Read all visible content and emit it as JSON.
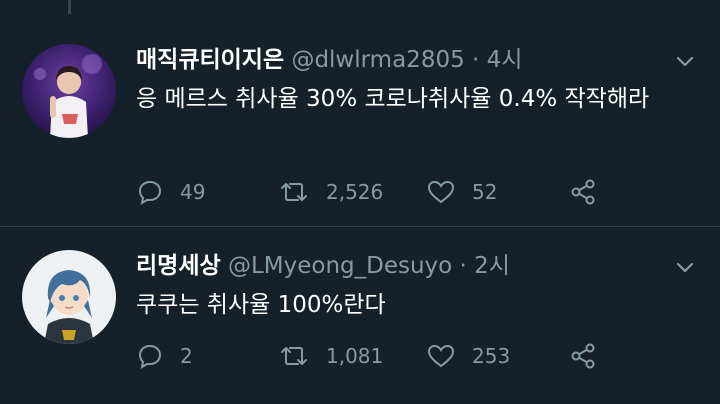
{
  "theme": {
    "background": "#15202b",
    "text": "#ffffff",
    "muted": "#8899a6"
  },
  "tweets": [
    {
      "display_name": "매직큐티이지은",
      "handle": "@dlwlrma2805",
      "separator": "·",
      "time": "4시",
      "text": "응 메르스 취사율 30% 코로나취사율 0.4% 작작해라",
      "replies": "49",
      "retweets": "2,526",
      "likes": "52"
    },
    {
      "display_name": "리명세상",
      "handle": "@LMyeong_Desuyo",
      "separator": "·",
      "time": "2시",
      "text": "쿠쿠는 취사율 100%란다",
      "replies": "2",
      "retweets": "1,081",
      "likes": "253"
    }
  ],
  "icons": {
    "reply": "reply-icon",
    "retweet": "retweet-icon",
    "like": "heart-icon",
    "share": "share-icon",
    "caret": "chevron-down-icon"
  }
}
